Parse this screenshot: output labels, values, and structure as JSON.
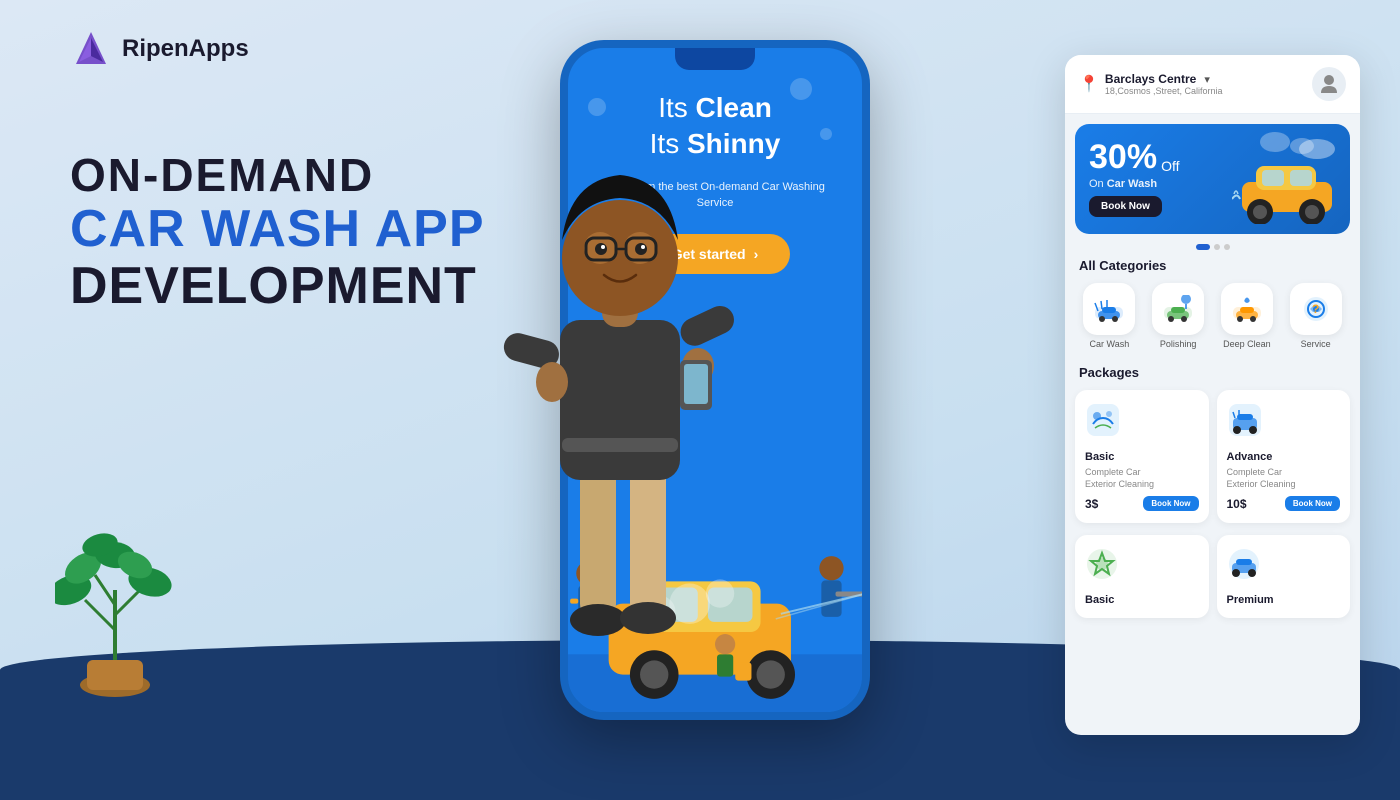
{
  "logo": {
    "text": "RipenApps"
  },
  "hero": {
    "line1": "ON-DEMAND",
    "line2": "CAR WASH APP",
    "line3": "DEVELOPMENT"
  },
  "phone_app": {
    "hero_text_1": "Its ",
    "hero_bold_1": "Clean",
    "hero_text_2": "Its ",
    "hero_bold_2": "Shinny",
    "sub": "Book from the best On-demand\nCar Washing Service",
    "cta": "Get started"
  },
  "app_ui": {
    "location_name": "Barclays Centre",
    "location_addr": "18,Cosmos ,Street, California",
    "promo_percent": "30%",
    "promo_off": "Off",
    "promo_on": "On ",
    "promo_car": "Car Wash",
    "promo_book": "Book Now",
    "dots": [
      true,
      false,
      false
    ],
    "all_categories_title": "All Categories",
    "categories": [
      {
        "label": "Car Wash",
        "icon": "🚗"
      },
      {
        "label": "Polishing",
        "icon": "🔵"
      },
      {
        "label": "Deep Clean",
        "icon": "🚙"
      },
      {
        "label": "Service",
        "icon": "⚙️"
      }
    ],
    "packages_title": "Packages",
    "packages": [
      {
        "name": "Basic",
        "desc": "Complete Car\nExterior Cleaning",
        "price": "3$",
        "book": "Book Now",
        "icon": "🫧"
      },
      {
        "name": "Advance",
        "desc": "Complete Car\nExterior Cleaning",
        "price": "10$",
        "book": "Book Now",
        "icon": "🚿"
      }
    ],
    "packages2": [
      {
        "name": "Basic",
        "icon": "🛡️"
      },
      {
        "name": "Premium",
        "icon": "🚗"
      }
    ]
  },
  "colors": {
    "accent_blue": "#2060d0",
    "brand_orange": "#f5a623",
    "dark_navy": "#1a1a2e",
    "bg_light": "#dce8f5",
    "bg_dark": "#1a3a6b"
  }
}
